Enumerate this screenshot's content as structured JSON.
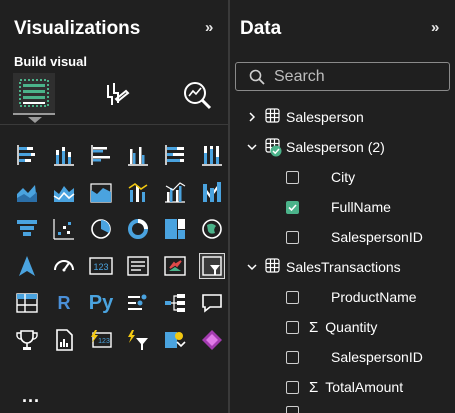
{
  "viz": {
    "title": "Visualizations",
    "collapse": "»",
    "build_visual_label": "Build visual",
    "more_label": "..."
  },
  "data_pane": {
    "title": "Data",
    "collapse": "»"
  },
  "search": {
    "placeholder": "Search"
  },
  "tree": [
    {
      "label": "Salesperson",
      "kind": "table",
      "expanded": false
    },
    {
      "label": "Salesperson (2)",
      "kind": "table",
      "expanded": true,
      "status": "in-use"
    },
    {
      "label": "City",
      "kind": "field",
      "checked": false
    },
    {
      "label": "FullName",
      "kind": "field",
      "checked": true
    },
    {
      "label": "SalespersonID",
      "kind": "field",
      "checked": false
    },
    {
      "label": "SalesTransactions",
      "kind": "table",
      "expanded": true
    },
    {
      "label": "ProductName",
      "kind": "field",
      "checked": false
    },
    {
      "label": "Quantity",
      "kind": "measure-field",
      "sigma": "Σ",
      "checked": false
    },
    {
      "label": "SalespersonID",
      "kind": "field",
      "checked": false
    },
    {
      "label": "TotalAmount",
      "kind": "measure-field",
      "sigma": "Σ",
      "checked": false
    }
  ],
  "visual_text_icons": {
    "python": "Py",
    "r": "R",
    "card_value": "123"
  },
  "colors": {
    "background": "#202020",
    "accent_green": "#4bb38a",
    "accent_blue": "#4aa3df",
    "text": "#ffffff"
  }
}
